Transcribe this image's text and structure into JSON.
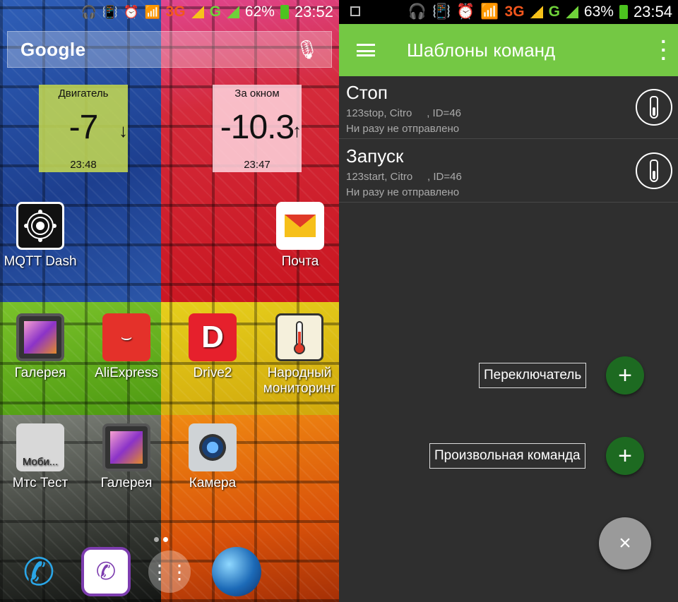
{
  "left": {
    "status": {
      "net1": "3G",
      "net2": "G",
      "battery": "62%",
      "time": "23:52"
    },
    "search": {
      "logo": "Google"
    },
    "widgets": [
      {
        "label": "Двигатель",
        "value": "-7",
        "time": "23:48",
        "arrow": "↓"
      },
      {
        "label": "За окном",
        "value": "-10.3",
        "time": "23:47",
        "arrow": "↑"
      }
    ],
    "apps": {
      "mqtt": "MQTT Dash",
      "mail": "Почта",
      "gallery1": "Галерея",
      "aliexpress": "AliExpress",
      "drive2": "Drive2",
      "drive2_icon": "D",
      "monitoring_line1": "Народный",
      "monitoring_line2": "мониторинг",
      "mts_icon": "Моби...",
      "mts": "Мтс Тест",
      "gallery2": "Галерея",
      "camera": "Камера"
    },
    "colors": {
      "blue": "#2f5fb8",
      "red": "#d42a3a",
      "green": "#4e9a12",
      "yellow": "#e6cf1c",
      "orange": "#f08a12"
    }
  },
  "right": {
    "status": {
      "net1": "3G",
      "net2": "G",
      "battery": "63%",
      "time": "23:54"
    },
    "appbar": {
      "title": "Шаблоны команд",
      "accent": "#74c844"
    },
    "items": [
      {
        "title": "Стоп",
        "sub": "123stop, Citro     , ID=46",
        "status": "Ни разу не отправлено"
      },
      {
        "title": "Запуск",
        "sub": "123start, Citro     , ID=46",
        "status": "Ни разу не отправлено"
      }
    ],
    "fab_actions": [
      {
        "label": "Переключатель",
        "icon": "+"
      },
      {
        "label": "Произвольная команда",
        "icon": "+"
      }
    ],
    "fab_close": "×"
  }
}
